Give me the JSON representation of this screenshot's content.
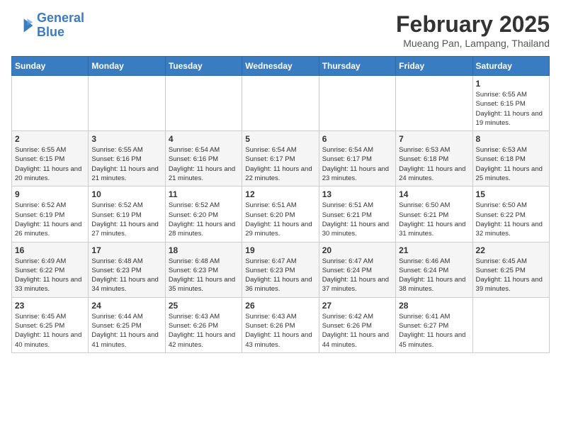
{
  "header": {
    "logo_line1": "General",
    "logo_line2": "Blue",
    "month": "February 2025",
    "location": "Mueang Pan, Lampang, Thailand"
  },
  "days_of_week": [
    "Sunday",
    "Monday",
    "Tuesday",
    "Wednesday",
    "Thursday",
    "Friday",
    "Saturday"
  ],
  "weeks": [
    [
      null,
      null,
      null,
      null,
      null,
      null,
      {
        "day": "1",
        "sunrise": "Sunrise: 6:55 AM",
        "sunset": "Sunset: 6:15 PM",
        "daylight": "Daylight: 11 hours and 19 minutes."
      }
    ],
    [
      {
        "day": "2",
        "sunrise": "Sunrise: 6:55 AM",
        "sunset": "Sunset: 6:15 PM",
        "daylight": "Daylight: 11 hours and 20 minutes."
      },
      {
        "day": "3",
        "sunrise": "Sunrise: 6:55 AM",
        "sunset": "Sunset: 6:16 PM",
        "daylight": "Daylight: 11 hours and 21 minutes."
      },
      {
        "day": "4",
        "sunrise": "Sunrise: 6:54 AM",
        "sunset": "Sunset: 6:16 PM",
        "daylight": "Daylight: 11 hours and 21 minutes."
      },
      {
        "day": "5",
        "sunrise": "Sunrise: 6:54 AM",
        "sunset": "Sunset: 6:17 PM",
        "daylight": "Daylight: 11 hours and 22 minutes."
      },
      {
        "day": "6",
        "sunrise": "Sunrise: 6:54 AM",
        "sunset": "Sunset: 6:17 PM",
        "daylight": "Daylight: 11 hours and 23 minutes."
      },
      {
        "day": "7",
        "sunrise": "Sunrise: 6:53 AM",
        "sunset": "Sunset: 6:18 PM",
        "daylight": "Daylight: 11 hours and 24 minutes."
      },
      {
        "day": "8",
        "sunrise": "Sunrise: 6:53 AM",
        "sunset": "Sunset: 6:18 PM",
        "daylight": "Daylight: 11 hours and 25 minutes."
      }
    ],
    [
      {
        "day": "9",
        "sunrise": "Sunrise: 6:52 AM",
        "sunset": "Sunset: 6:19 PM",
        "daylight": "Daylight: 11 hours and 26 minutes."
      },
      {
        "day": "10",
        "sunrise": "Sunrise: 6:52 AM",
        "sunset": "Sunset: 6:19 PM",
        "daylight": "Daylight: 11 hours and 27 minutes."
      },
      {
        "day": "11",
        "sunrise": "Sunrise: 6:52 AM",
        "sunset": "Sunset: 6:20 PM",
        "daylight": "Daylight: 11 hours and 28 minutes."
      },
      {
        "day": "12",
        "sunrise": "Sunrise: 6:51 AM",
        "sunset": "Sunset: 6:20 PM",
        "daylight": "Daylight: 11 hours and 29 minutes."
      },
      {
        "day": "13",
        "sunrise": "Sunrise: 6:51 AM",
        "sunset": "Sunset: 6:21 PM",
        "daylight": "Daylight: 11 hours and 30 minutes."
      },
      {
        "day": "14",
        "sunrise": "Sunrise: 6:50 AM",
        "sunset": "Sunset: 6:21 PM",
        "daylight": "Daylight: 11 hours and 31 minutes."
      },
      {
        "day": "15",
        "sunrise": "Sunrise: 6:50 AM",
        "sunset": "Sunset: 6:22 PM",
        "daylight": "Daylight: 11 hours and 32 minutes."
      }
    ],
    [
      {
        "day": "16",
        "sunrise": "Sunrise: 6:49 AM",
        "sunset": "Sunset: 6:22 PM",
        "daylight": "Daylight: 11 hours and 33 minutes."
      },
      {
        "day": "17",
        "sunrise": "Sunrise: 6:48 AM",
        "sunset": "Sunset: 6:23 PM",
        "daylight": "Daylight: 11 hours and 34 minutes."
      },
      {
        "day": "18",
        "sunrise": "Sunrise: 6:48 AM",
        "sunset": "Sunset: 6:23 PM",
        "daylight": "Daylight: 11 hours and 35 minutes."
      },
      {
        "day": "19",
        "sunrise": "Sunrise: 6:47 AM",
        "sunset": "Sunset: 6:23 PM",
        "daylight": "Daylight: 11 hours and 36 minutes."
      },
      {
        "day": "20",
        "sunrise": "Sunrise: 6:47 AM",
        "sunset": "Sunset: 6:24 PM",
        "daylight": "Daylight: 11 hours and 37 minutes."
      },
      {
        "day": "21",
        "sunrise": "Sunrise: 6:46 AM",
        "sunset": "Sunset: 6:24 PM",
        "daylight": "Daylight: 11 hours and 38 minutes."
      },
      {
        "day": "22",
        "sunrise": "Sunrise: 6:45 AM",
        "sunset": "Sunset: 6:25 PM",
        "daylight": "Daylight: 11 hours and 39 minutes."
      }
    ],
    [
      {
        "day": "23",
        "sunrise": "Sunrise: 6:45 AM",
        "sunset": "Sunset: 6:25 PM",
        "daylight": "Daylight: 11 hours and 40 minutes."
      },
      {
        "day": "24",
        "sunrise": "Sunrise: 6:44 AM",
        "sunset": "Sunset: 6:25 PM",
        "daylight": "Daylight: 11 hours and 41 minutes."
      },
      {
        "day": "25",
        "sunrise": "Sunrise: 6:43 AM",
        "sunset": "Sunset: 6:26 PM",
        "daylight": "Daylight: 11 hours and 42 minutes."
      },
      {
        "day": "26",
        "sunrise": "Sunrise: 6:43 AM",
        "sunset": "Sunset: 6:26 PM",
        "daylight": "Daylight: 11 hours and 43 minutes."
      },
      {
        "day": "27",
        "sunrise": "Sunrise: 6:42 AM",
        "sunset": "Sunset: 6:26 PM",
        "daylight": "Daylight: 11 hours and 44 minutes."
      },
      {
        "day": "28",
        "sunrise": "Sunrise: 6:41 AM",
        "sunset": "Sunset: 6:27 PM",
        "daylight": "Daylight: 11 hours and 45 minutes."
      },
      null
    ]
  ]
}
